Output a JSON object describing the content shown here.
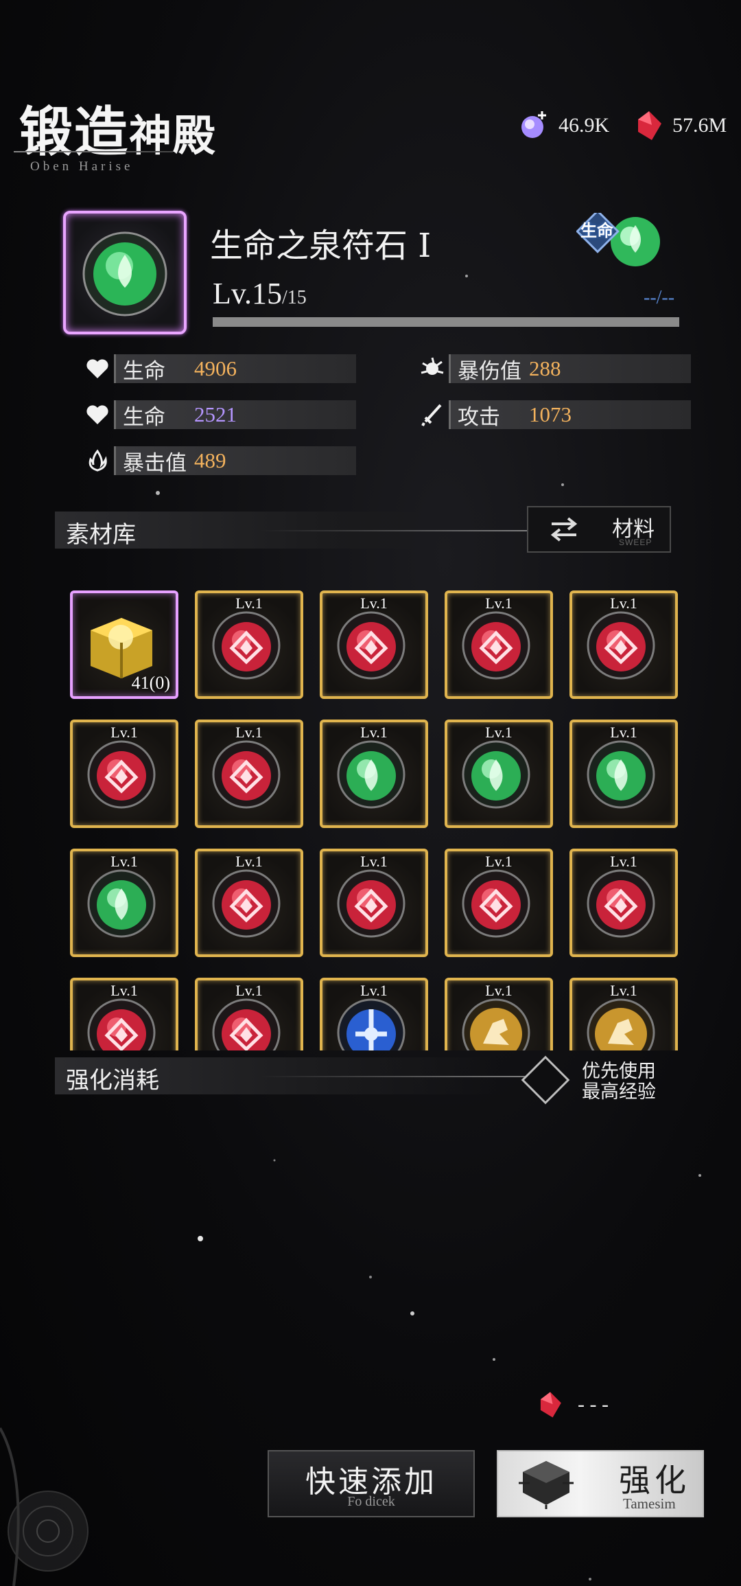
{
  "header": {
    "title_a": "锻造",
    "title_b": "神殿",
    "subtitle": "Oben Harise",
    "currency_purple": "46.9K",
    "currency_red": "57.6M"
  },
  "item": {
    "name": "生命之泉符石 I",
    "level": "Lv.15",
    "level_max": "/15",
    "xp_text": "--/--",
    "xp_fraction": 1.0,
    "type_badge": "生命"
  },
  "stats": {
    "left": [
      {
        "icon": "heart-icon",
        "label": "生命",
        "value": "4906",
        "color": "gold"
      },
      {
        "icon": "heart-icon",
        "label": "生命",
        "value": "2521",
        "color": "purple"
      },
      {
        "icon": "flame-icon",
        "label": "暴击值",
        "value": "489",
        "color": "gold"
      }
    ],
    "right": [
      {
        "icon": "crit-damage-icon",
        "label": "暴伤值",
        "value": "288",
        "color": "gold"
      },
      {
        "icon": "sword-icon",
        "label": "攻击",
        "value": "1073",
        "color": "gold"
      }
    ]
  },
  "material_section": {
    "label": "素材库",
    "sweep_label": "材料",
    "sweep_sub": "SWEEP"
  },
  "grid": [
    {
      "kind": "chest",
      "count": "41(0)",
      "frame": "purple"
    },
    {
      "kind": "red",
      "lv": "Lv.1"
    },
    {
      "kind": "red",
      "lv": "Lv.1"
    },
    {
      "kind": "red",
      "lv": "Lv.1"
    },
    {
      "kind": "red",
      "lv": "Lv.1"
    },
    {
      "kind": "red",
      "lv": "Lv.1"
    },
    {
      "kind": "red",
      "lv": "Lv.1"
    },
    {
      "kind": "green",
      "lv": "Lv.1"
    },
    {
      "kind": "green",
      "lv": "Lv.1"
    },
    {
      "kind": "green",
      "lv": "Lv.1"
    },
    {
      "kind": "green",
      "lv": "Lv.1"
    },
    {
      "kind": "red",
      "lv": "Lv.1"
    },
    {
      "kind": "red",
      "lv": "Lv.1"
    },
    {
      "kind": "red",
      "lv": "Lv.1"
    },
    {
      "kind": "red",
      "lv": "Lv.1"
    },
    {
      "kind": "red",
      "lv": "Lv.1"
    },
    {
      "kind": "red",
      "lv": "Lv.1"
    },
    {
      "kind": "blue",
      "lv": "Lv.1"
    },
    {
      "kind": "gold",
      "lv": "Lv.1"
    },
    {
      "kind": "gold",
      "lv": "Lv.1"
    }
  ],
  "consume_section": {
    "label": "强化消耗",
    "priority_line1": "优先使用",
    "priority_line2": "最高经验"
  },
  "cost": {
    "value": "- - -"
  },
  "buttons": {
    "quick_add": "快速添加",
    "quick_add_sub": "Fo dicek",
    "enhance": "强化",
    "enhance_sub": "Tamesim"
  },
  "colors": {
    "gold_frame": "#e0b44e",
    "purple_frame": "#e6a0ff",
    "stat_gold": "#f3b25d",
    "stat_purple": "#b596ff"
  }
}
